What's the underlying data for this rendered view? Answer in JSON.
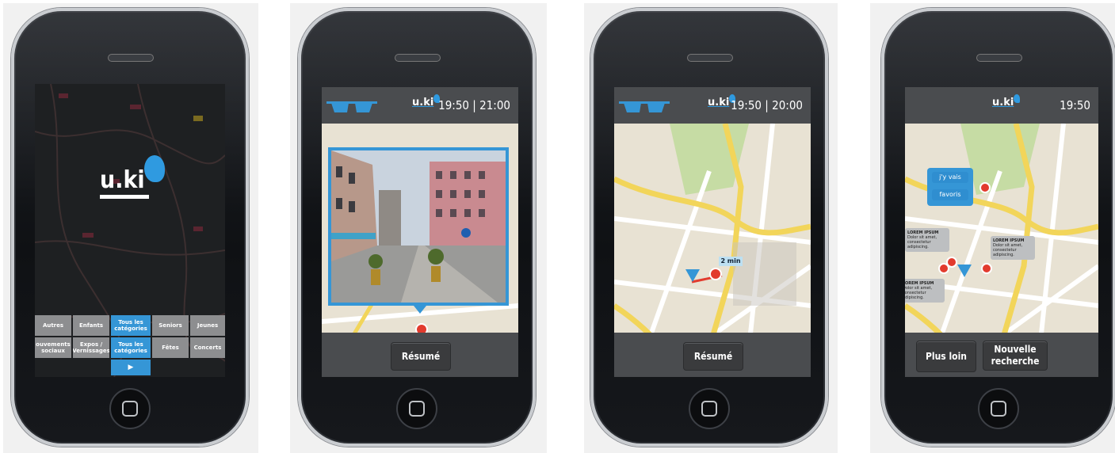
{
  "splash": {
    "logo_text": "u.ki",
    "categories": [
      {
        "label": "Autres",
        "selected": false
      },
      {
        "label": "Enfants",
        "selected": false
      },
      {
        "label": "Tous les catégories",
        "selected": true
      },
      {
        "label": "Seniors",
        "selected": false
      },
      {
        "label": "Jeunes",
        "selected": false
      },
      {
        "label": "ouvements sociaux",
        "selected": false
      },
      {
        "label": "Expos / Vernissages",
        "selected": false
      },
      {
        "label": "Tous les catégories",
        "selected": true
      },
      {
        "label": "Fêtes",
        "selected": false
      },
      {
        "label": "Concerts",
        "selected": false
      }
    ],
    "next_glyph": "▶"
  },
  "streetview": {
    "brand": "u.ki",
    "time": "19:50 | 21:00",
    "summary_button": "Résumé"
  },
  "route": {
    "brand": "u.ki",
    "time": "19:50 | 20:00",
    "duration_label": "2 min",
    "summary_button": "Résumé"
  },
  "events": {
    "brand": "u.ki",
    "time": "19:50",
    "popup_go": "j'y vais",
    "popup_fav": "favoris",
    "bubble_title": "LOREM IPSUM",
    "bubble_text": "Dolor sit amet, consectetur adipiscing.",
    "button_farther": "Plus loin",
    "button_new_search": "Nouvelle recherche"
  },
  "colors": {
    "accent": "#3596d6",
    "marker": "#e23b2e",
    "bar": "#4a4c4f"
  }
}
